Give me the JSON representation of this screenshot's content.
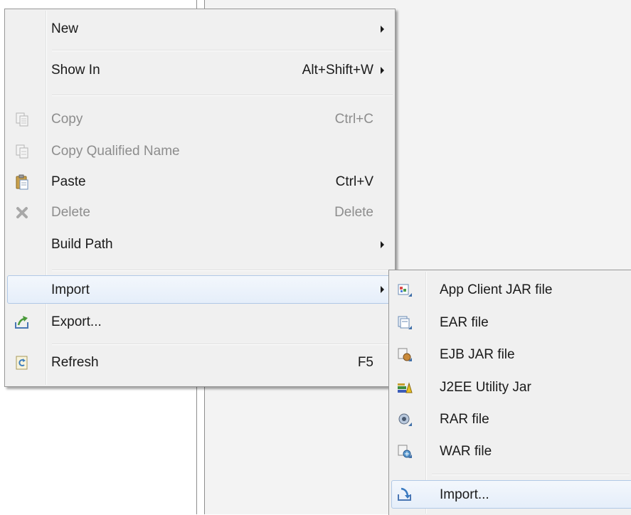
{
  "context_menu": {
    "items": [
      {
        "label": "New"
      },
      {
        "label": "Show In",
        "shortcut": "Alt+Shift+W"
      },
      {
        "label": "Copy",
        "shortcut": "Ctrl+C"
      },
      {
        "label": "Copy Qualified Name"
      },
      {
        "label": "Paste",
        "shortcut": "Ctrl+V"
      },
      {
        "label": "Delete",
        "shortcut": "Delete"
      },
      {
        "label": "Build Path"
      },
      {
        "label": "Import"
      },
      {
        "label": "Export..."
      },
      {
        "label": "Refresh",
        "shortcut": "F5"
      }
    ]
  },
  "submenu": {
    "items": [
      {
        "label": "App Client JAR file",
        "icon": "app-client-jar-icon"
      },
      {
        "label": "EAR file",
        "icon": "ear-file-icon"
      },
      {
        "label": "EJB JAR file",
        "icon": "ejb-jar-icon"
      },
      {
        "label": "J2EE Utility Jar",
        "icon": "j2ee-utility-jar-icon"
      },
      {
        "label": "RAR file",
        "icon": "rar-file-icon"
      },
      {
        "label": "WAR file",
        "icon": "war-file-icon"
      },
      {
        "label": "Import...",
        "icon": "import-icon"
      }
    ]
  },
  "colors": {
    "menu_bg": "#f0f0f0",
    "highlight": "#e5eefa",
    "highlight_border": "#b0c8e6",
    "disabled_text": "#8d8d8d"
  }
}
